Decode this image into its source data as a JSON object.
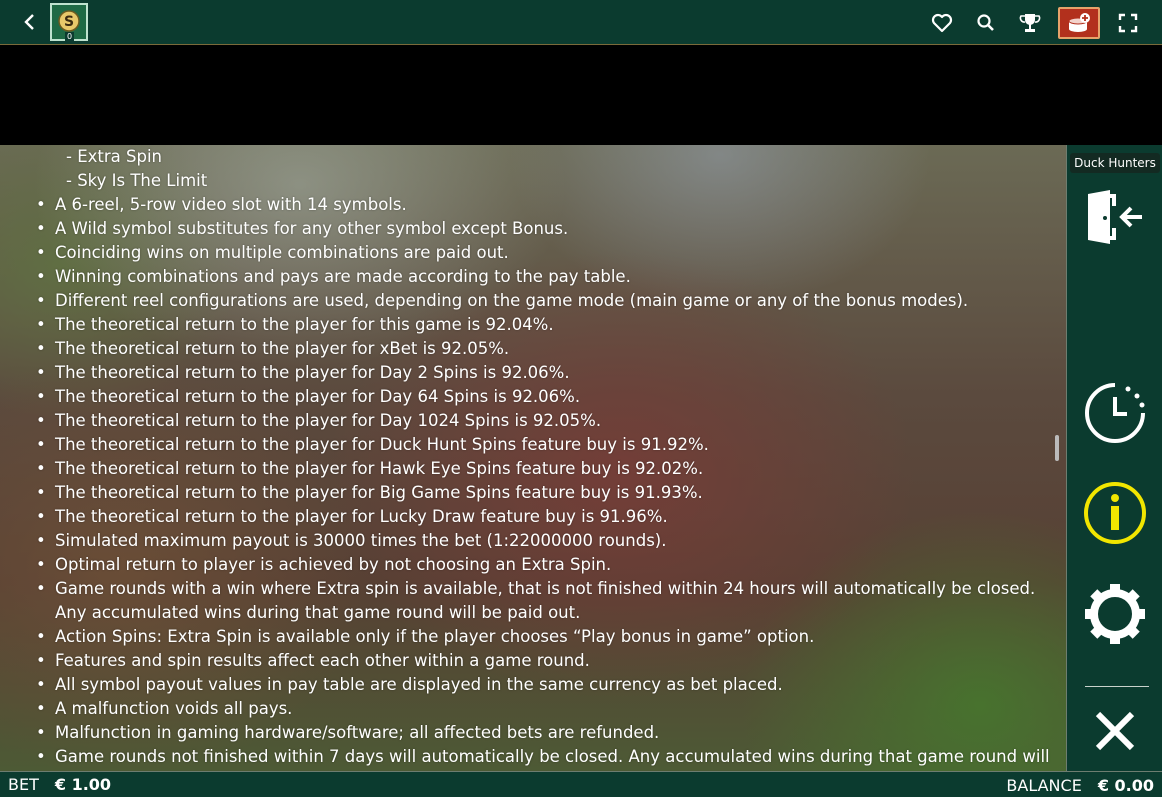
{
  "topbar": {
    "logo_letter": "S",
    "logo_badge": "0",
    "icons": [
      "back-icon",
      "heart-icon",
      "search-icon",
      "trophy-icon",
      "cashier-icon",
      "fullscreen-icon"
    ]
  },
  "rules": [
    {
      "text": "- Extra Spin",
      "kind": "sub"
    },
    {
      "text": "- Sky Is The Limit",
      "kind": "sub"
    },
    {
      "text": "A 6-reel, 5-row video slot with 14 symbols.",
      "kind": "bullet"
    },
    {
      "text": "A Wild symbol substitutes for any other symbol except Bonus.",
      "kind": "bullet"
    },
    {
      "text": "Coinciding wins on multiple combinations are paid out.",
      "kind": "bullet"
    },
    {
      "text": "Winning combinations and pays are made according to the pay table.",
      "kind": "bullet"
    },
    {
      "text": "Different reel configurations are used, depending on the game mode (main game or any of the bonus modes).",
      "kind": "bullet"
    },
    {
      "text": "The theoretical return to the player for this game is 92.04%.",
      "kind": "bullet"
    },
    {
      "text": "The theoretical return to the player for xBet is 92.05%.",
      "kind": "bullet"
    },
    {
      "text": "The theoretical return to the player for Day 2 Spins is 92.06%.",
      "kind": "bullet"
    },
    {
      "text": "The theoretical return to the player for Day 64 Spins is 92.06%.",
      "kind": "bullet"
    },
    {
      "text": "The theoretical return to the player for Day 1024 Spins is 92.05%.",
      "kind": "bullet"
    },
    {
      "text": "The theoretical return to the player for Duck Hunt Spins feature buy is 91.92%.",
      "kind": "bullet"
    },
    {
      "text": "The theoretical return to the player for Hawk Eye Spins feature buy is 92.02%.",
      "kind": "bullet"
    },
    {
      "text": "The theoretical return to the player for Big Game Spins feature buy is 91.93%.",
      "kind": "bullet"
    },
    {
      "text": "The theoretical return to the player for Lucky Draw feature buy is 91.96%.",
      "kind": "bullet"
    },
    {
      "text": "Simulated maximum payout is 30000 times the bet (1:22000000 rounds).",
      "kind": "bullet"
    },
    {
      "text": "Optimal return to player is achieved by not choosing an Extra Spin.",
      "kind": "bullet"
    },
    {
      "text": "Game rounds with a win where Extra spin is available, that is not finished within 24 hours will automatically be closed. Any accumulated wins during that game round will be paid out.",
      "kind": "bullet wrap"
    },
    {
      "text": "Action Spins: Extra Spin is available only if the player chooses “Play bonus in game” option.",
      "kind": "bullet"
    },
    {
      "text": "Features and spin results affect each other within a game round.",
      "kind": "bullet"
    },
    {
      "text": "All symbol payout values in pay table are displayed in the same currency as bet placed.",
      "kind": "bullet"
    },
    {
      "text": "A malfunction voids all pays.",
      "kind": "bullet"
    },
    {
      "text": "Malfunction in gaming hardware/software; all affected bets are refunded.",
      "kind": "bullet"
    },
    {
      "text": "Game rounds not finished within 7 days will automatically be closed. Any accumulated wins during that game round will",
      "kind": "bullet"
    }
  ],
  "sidepanel": {
    "game_name": "Duck Hunters",
    "buttons": [
      "exit-icon",
      "history-clock-icon",
      "info-icon",
      "settings-gear-icon",
      "close-icon"
    ],
    "info_color": "#f2e600"
  },
  "bottombar": {
    "bet_label": "BET",
    "bet_value": "€ 1.00",
    "balance_label": "BALANCE",
    "balance_value": "€ 0.00"
  }
}
